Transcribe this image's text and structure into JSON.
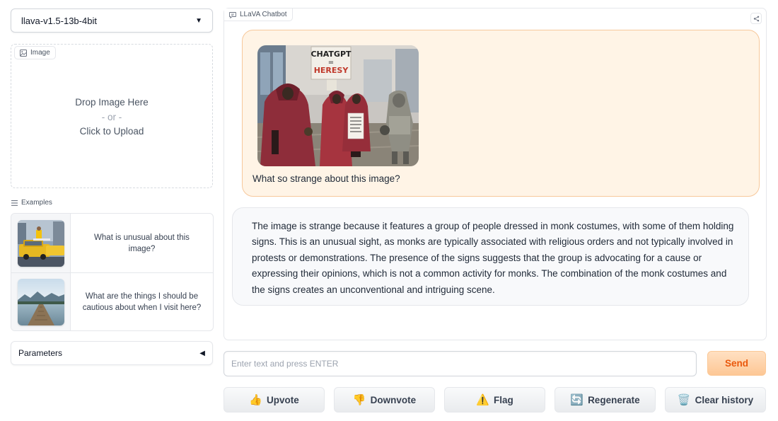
{
  "model_selector": {
    "value": "llava-v1.5-13b-4bit",
    "icon": "chevron-down-icon"
  },
  "image_upload": {
    "label": "Image",
    "drop_text": "Drop Image Here",
    "or_text": "- or -",
    "click_text": "Click to Upload"
  },
  "examples": {
    "label": "Examples",
    "items": [
      {
        "text": "What is unusual about this image?",
        "thumb": "taxi-ironing-photo"
      },
      {
        "text": "What are the things I should be cautious about when I visit here?",
        "thumb": "lake-pier-photo"
      }
    ]
  },
  "parameters": {
    "label": "Parameters",
    "icon": "triangle-left-icon"
  },
  "chatbot": {
    "label": "LLaVA Chatbot",
    "image_sign": {
      "line1": "CHATGPT",
      "line2": "=",
      "line3": "HERESY"
    },
    "user_message": "What so strange about this image?",
    "bot_message": "The image is strange because it features a group of people dressed in monk costumes, with some of them holding signs. This is an unusual sight, as monks are typically associated with religious orders and not typically involved in protests or demonstrations. The presence of the signs suggests that the group is advocating for a cause or expressing their opinions, which is not a common activity for monks. The combination of the monk costumes and the signs creates an unconventional and intriguing scene."
  },
  "input": {
    "placeholder": "Enter text and press ENTER",
    "value": ""
  },
  "send_button": {
    "label": "Send"
  },
  "actions": [
    {
      "label": "Upvote",
      "icon": "👍"
    },
    {
      "label": "Downvote",
      "icon": "👎"
    },
    {
      "label": "Flag",
      "icon": "⚠️"
    },
    {
      "label": "Regenerate",
      "icon": "🔄"
    },
    {
      "label": "Clear history",
      "icon": "🗑️"
    }
  ],
  "colors": {
    "user_bubble_bg": "#fff4e6",
    "user_bubble_border": "#f7c89b",
    "send_text": "#ea580c",
    "bot_bubble_bg": "#f8f9fb"
  }
}
